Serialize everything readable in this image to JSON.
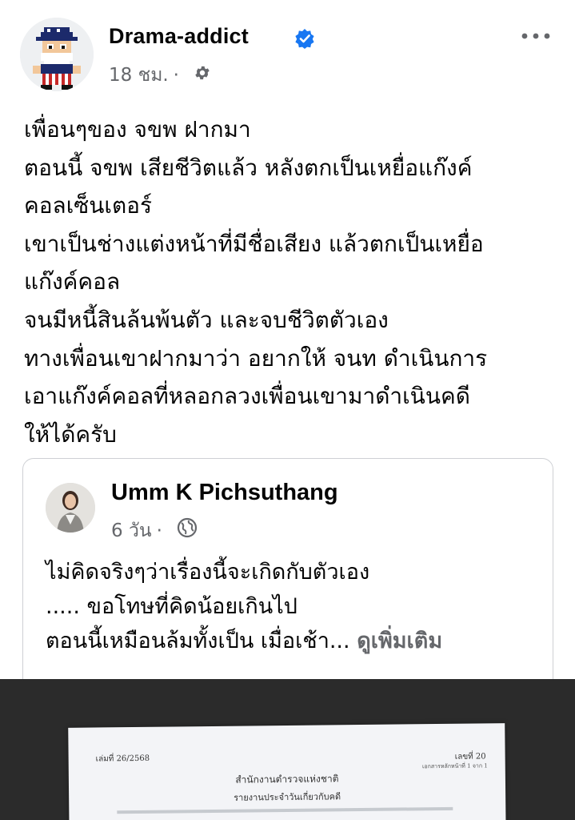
{
  "post": {
    "author": "Drama-addict",
    "time": "18 ชม.",
    "separator": "·",
    "body_lines": [
      "เพื่อนๆของ จขพ ฝากมา",
      "ตอนนี้ จขพ เสียชีวิตแล้ว หลังตกเป็นเหยื่อแก๊งค์",
      "คอลเซ็นเตอร์",
      "เขาเป็นช่างแต่งหน้าที่มีชื่อเสียง แล้วตกเป็นเหยื่อ",
      "แก๊งค์คอล",
      "จนมีหนี้สินล้นพ้นตัว และจบชีวิตตัวเอง",
      "ทางเพื่อนเขาฝากมาว่า อยากให้ จนท ดำเนินการ",
      "เอาแก๊งค์คอลที่หลอกลวงเพื่อนเขามาดำเนินคดี",
      "ให้ได้ครับ"
    ],
    "icons": {
      "verified": "verified-badge-icon",
      "audience": "gear-icon",
      "more": "more-options-icon"
    },
    "colors": {
      "verified": "#1877f2",
      "secondary_text": "#65676b"
    }
  },
  "shared_post": {
    "author": "Umm K Pichsuthang",
    "time": "6 วัน",
    "separator": "·",
    "body_lines": [
      "ไม่คิดจริงๆว่าเรื่องนี้จะเกิดกับตัวเอง",
      "..... ขอโทษที่คิดน้อยเกินไป",
      "ตอนนี้เหมือนล้มทั้งเป็น   เมื่อเช้า..."
    ],
    "see_more": "ดูเพิ่มเติม",
    "icons": {
      "audience": "globe-icon"
    }
  },
  "photo_document": {
    "number_left": "เล่มที่ 26/2568",
    "number_right": "เลขที่ 20",
    "sub_right": "เอกสารหลักหน้าที่ 1 จาก 1",
    "title": "สำนักงานตำรวจแห่งชาติ",
    "subtitle": "รายงานประจำวันเกี่ยวกับคดี"
  }
}
